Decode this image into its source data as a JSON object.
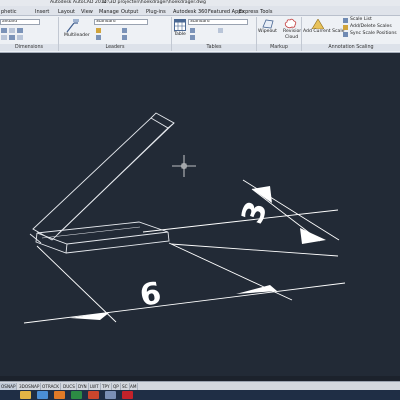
{
  "window": {
    "app_title": "Autodesk AutoCAD 2014",
    "file_path": "D:\\3D projecten\\hoekdrager\\hoekdrager.dwg"
  },
  "tabs": [
    {
      "label": "phetic",
      "active": false
    },
    {
      "label": "Insert",
      "active": false
    },
    {
      "label": "Layout",
      "active": false
    },
    {
      "label": "View",
      "active": false
    },
    {
      "label": "Manage",
      "active": false
    },
    {
      "label": "Output",
      "active": false
    },
    {
      "label": "Plug-ins",
      "active": false
    },
    {
      "label": "Autodesk 360",
      "active": false
    },
    {
      "label": "Featured Apps",
      "active": false
    },
    {
      "label": "Express Tools",
      "active": false
    }
  ],
  "ribbon": {
    "dim_style_value": "andard",
    "dimensions_panel": "Dimensions",
    "mleader_style_value": "Standard",
    "multileader_label": "Multileader",
    "leaders_panel": "Leaders",
    "table_style_value": "Standard",
    "table_label": "Table",
    "tables_panel": "Tables",
    "wipeout_label": "Wipeout",
    "revcloud_label_line1": "Revision",
    "revcloud_label_line2": "Cloud",
    "markup_panel": "Markup",
    "add_scale_label": "Add Current Scale",
    "scale_list_label": "Scale List",
    "add_delete_scales_label": "Add/Delete Scales",
    "sync_scale_label": "Sync Scale Positions",
    "annotation_scaling_panel": "Annotation Scaling"
  },
  "drawing": {
    "dim_vertical_text": "3",
    "dim_horizontal_text": "6",
    "background_color": "#222a36",
    "line_color": "#ffffff"
  },
  "statusbar": {
    "buttons": [
      {
        "label": "OSNAP",
        "on": true
      },
      {
        "label": "3DOSNAP",
        "on": false
      },
      {
        "label": "OTRACK",
        "on": false
      },
      {
        "label": "DUCS",
        "on": false
      },
      {
        "label": "DYN",
        "on": false
      },
      {
        "label": "LWT",
        "on": false
      },
      {
        "label": "TPY",
        "on": false
      },
      {
        "label": "QP",
        "on": false
      },
      {
        "label": "SC",
        "on": false
      },
      {
        "label": "AM",
        "on": false
      }
    ]
  },
  "taskbar": {
    "icons": [
      "folder-icon",
      "browser-icon",
      "media-player-icon",
      "excel-icon",
      "powerpoint-icon",
      "app-icon",
      "autocad-icon"
    ]
  }
}
